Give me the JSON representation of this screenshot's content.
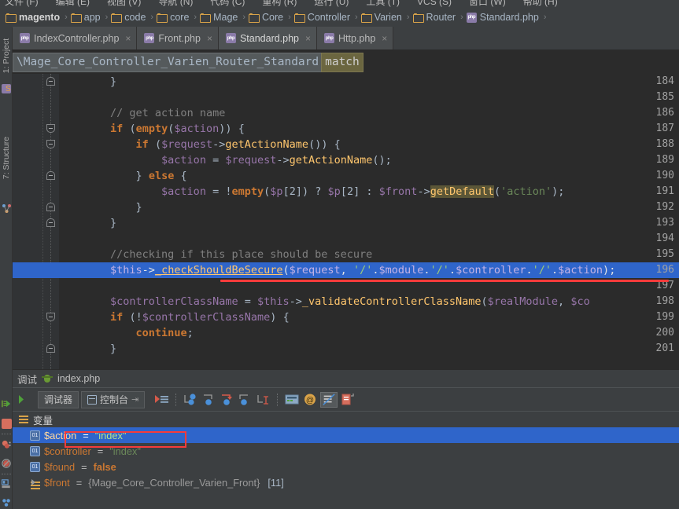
{
  "menu": {
    "items": [
      "文件 (F)",
      "编辑 (E)",
      "视图 (V)",
      "导航 (N)",
      "代码 (C)",
      "重构 (R)",
      "运行 (U)",
      "工具 (T)",
      "VCS (S)",
      "窗口 (W)",
      "帮助 (H)"
    ]
  },
  "breadcrumb": {
    "items": [
      {
        "label": "magento",
        "icon": "folder-icon",
        "bold": true
      },
      {
        "label": "app",
        "icon": "folder-icon",
        "bold": false
      },
      {
        "label": "code",
        "icon": "folder-icon",
        "bold": false
      },
      {
        "label": "core",
        "icon": "folder-icon",
        "bold": false
      },
      {
        "label": "Mage",
        "icon": "folder-icon",
        "bold": false
      },
      {
        "label": "Core",
        "icon": "folder-icon",
        "bold": false
      },
      {
        "label": "Controller",
        "icon": "folder-icon",
        "bold": false
      },
      {
        "label": "Varien",
        "icon": "folder-icon",
        "bold": false
      },
      {
        "label": "Router",
        "icon": "folder-icon",
        "bold": false
      },
      {
        "label": "Standard.php",
        "icon": "php-file-icon",
        "bold": false
      }
    ],
    "separator": "›"
  },
  "sidebar": {
    "tool_windows": [
      {
        "label": "1: Project",
        "icon": "project-icon"
      },
      {
        "label": "7: Structure",
        "icon": "structure-icon"
      }
    ]
  },
  "tabs": [
    {
      "label": "IndexController.php",
      "active": false,
      "close": "×"
    },
    {
      "label": "Front.php",
      "active": false,
      "close": "×"
    },
    {
      "label": "Standard.php",
      "active": true,
      "close": "×"
    },
    {
      "label": "Http.php",
      "active": false,
      "close": "×"
    }
  ],
  "editor_nav": {
    "class_path": "\\Mage_Core_Controller_Varien_Router_Standard",
    "method": "match"
  },
  "editor": {
    "first_line": 184,
    "highlighted_line": 196,
    "lines": [
      {
        "n": 184,
        "fold": "up",
        "text": "        }"
      },
      {
        "n": 185,
        "fold": null,
        "text": ""
      },
      {
        "n": 186,
        "fold": null,
        "text": "        // get action name"
      },
      {
        "n": 187,
        "fold": "down",
        "text": "        if (empty($action)) {"
      },
      {
        "n": 188,
        "fold": "down",
        "text": "            if ($request->getActionName()) {"
      },
      {
        "n": 189,
        "fold": null,
        "text": "                $action = $request->getActionName();"
      },
      {
        "n": 190,
        "fold": "up",
        "text": "            } else {"
      },
      {
        "n": 191,
        "fold": null,
        "text": "                $action = !empty($p[2]) ? $p[2] : $front->getDefault('action');"
      },
      {
        "n": 192,
        "fold": "up",
        "text": "            }"
      },
      {
        "n": 193,
        "fold": "up",
        "text": "        }"
      },
      {
        "n": 194,
        "fold": null,
        "text": ""
      },
      {
        "n": 195,
        "fold": null,
        "text": "        //checking if this place should be secure"
      },
      {
        "n": 196,
        "fold": null,
        "text": "        $this->_checkShouldBeSecure($request, '/'.$module.'/'.$controller.'/'.$action);"
      },
      {
        "n": 197,
        "fold": null,
        "text": ""
      },
      {
        "n": 198,
        "fold": null,
        "text": "        $controllerClassName = $this->_validateControllerClassName($realModule, $co"
      },
      {
        "n": 199,
        "fold": "down",
        "text": "        if (!$controllerClassName) {"
      },
      {
        "n": 200,
        "fold": null,
        "text": "            continue;"
      },
      {
        "n": 201,
        "fold": "up",
        "text": "        }"
      }
    ]
  },
  "debug": {
    "title": "调试",
    "title_file": "index.php",
    "tabs": [
      {
        "label": "调试器",
        "icon": "debugger-icon",
        "active": true
      },
      {
        "label": "控制台",
        "icon": "console-icon",
        "active": false
      }
    ],
    "pin_glyph": "⇥",
    "toolbar_buttons": [
      {
        "name": "show-execution-point-icon"
      },
      {
        "name": "step-over-icon"
      },
      {
        "name": "step-into-icon"
      },
      {
        "name": "force-step-into-icon"
      },
      {
        "name": "step-out-icon"
      },
      {
        "name": "run-to-cursor-icon"
      },
      {
        "name": "evaluate-expression-icon"
      },
      {
        "name": "at-icon"
      },
      {
        "name": "mute-breakpoints-icon"
      },
      {
        "name": "copy-frame-icon"
      }
    ],
    "left_buttons": [
      {
        "name": "resume-program-icon"
      },
      {
        "name": "stop-icon"
      },
      {
        "name": "view-breakpoints-icon"
      },
      {
        "name": "mute-breakpoints-icon"
      },
      {
        "name": "settings-icon"
      },
      {
        "name": "pin-icon"
      }
    ],
    "variables_header": "变量",
    "variables": [
      {
        "name": "$action",
        "eq": "=",
        "value": "\"index\"",
        "kind": "string",
        "selected": true,
        "expandable": false,
        "icon": "variable-icon"
      },
      {
        "name": "$controller",
        "eq": "=",
        "value": "\"index\"",
        "kind": "string",
        "selected": false,
        "expandable": false,
        "icon": "variable-icon"
      },
      {
        "name": "$found",
        "eq": "=",
        "value": "false",
        "kind": "bool",
        "selected": false,
        "expandable": false,
        "icon": "variable-icon"
      },
      {
        "name": "$front",
        "eq": "=",
        "value": "{Mage_Core_Controller_Varien_Front}",
        "count": "[11]",
        "kind": "object",
        "selected": false,
        "expandable": true,
        "icon": "object-icon"
      }
    ]
  },
  "colors": {
    "accent_blue": "#2f65ca",
    "annotation_red": "#f63b3b",
    "editor_bg": "#2b2b2b",
    "panel_bg": "#3c3f41",
    "keyword": "#cc7832",
    "variable": "#9876aa",
    "function": "#ffc66d",
    "string": "#6a8759",
    "comment": "#808080"
  }
}
